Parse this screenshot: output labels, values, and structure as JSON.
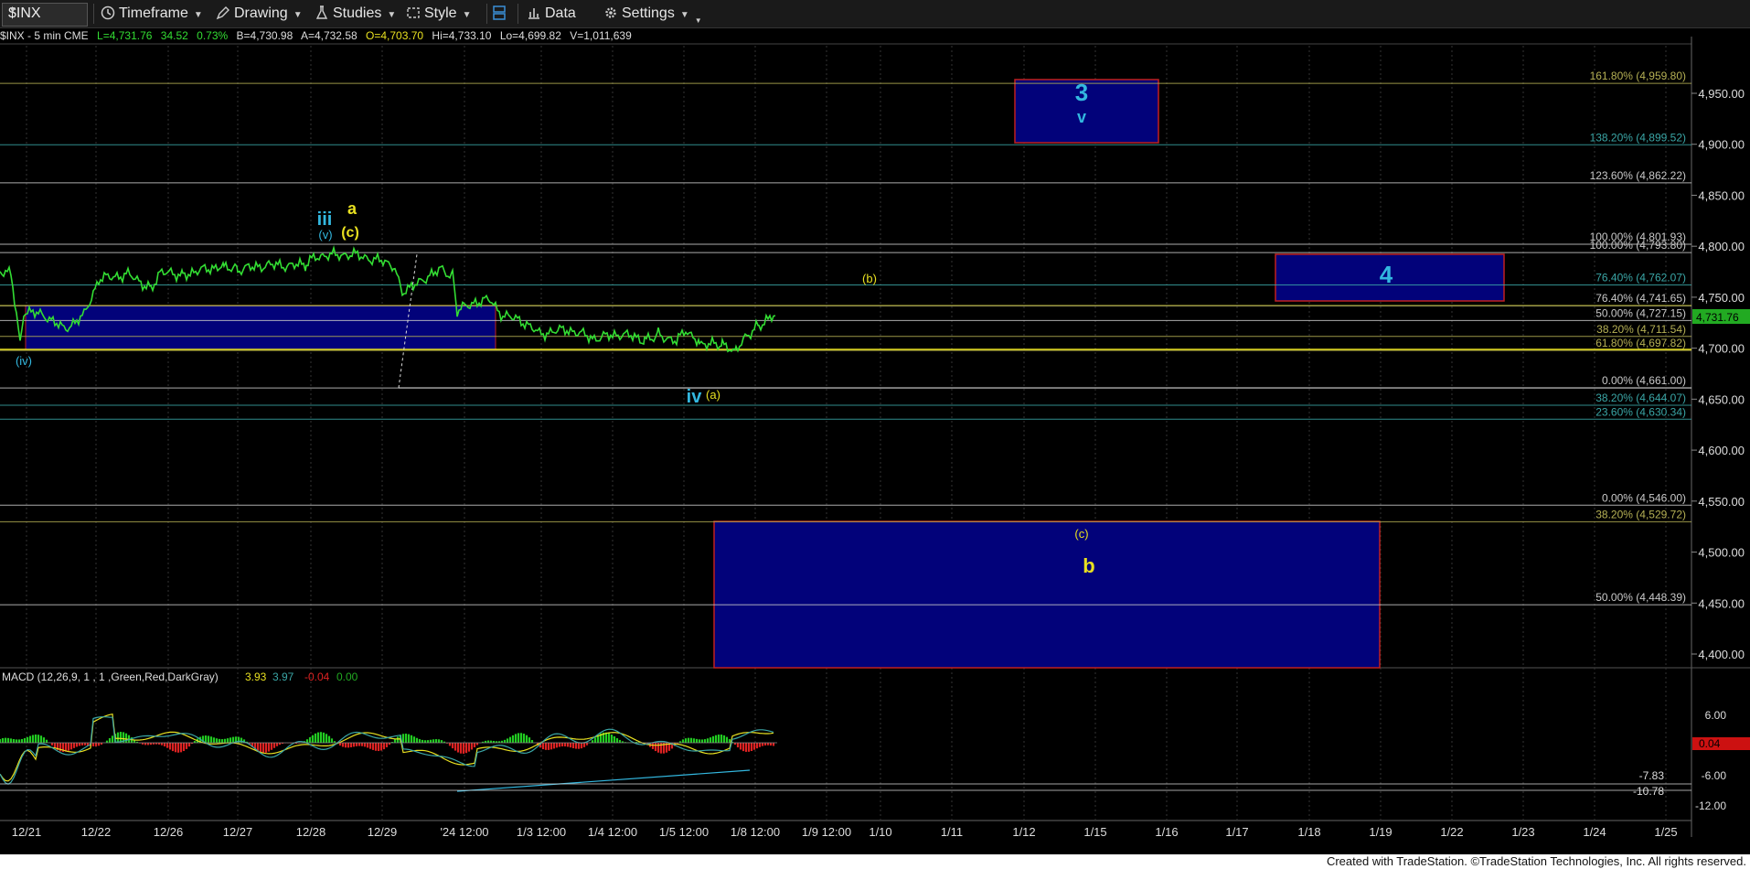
{
  "toolbar": {
    "symbol": "$INX",
    "timeframe": "Timeframe",
    "drawing": "Drawing",
    "studies": "Studies",
    "style": "Style",
    "data": "Data",
    "settings": "Settings"
  },
  "status": {
    "symbol": "$INX - 5 min  CME",
    "last": "L=4,731.76",
    "chg": "34.52",
    "pct": "0.73%",
    "bid": "B=4,730.98",
    "ask": "A=4,732.58",
    "open": "O=4,703.70",
    "hi": "Hi=4,733.10",
    "lo": "Lo=4,699.82",
    "vol": "V=1,011,639"
  },
  "price_axis": {
    "labels": [
      "4,950.00",
      "4,900.00",
      "4,850.00",
      "4,800.00",
      "4,750.00",
      "4,700.00",
      "4,650.00",
      "4,600.00",
      "4,550.00",
      "4,500.00",
      "4,450.00",
      "4,400.00"
    ],
    "last_price": "4,731.76"
  },
  "macd_axis": {
    "labels": [
      "6.00",
      "-6.00",
      "-12.00"
    ],
    "value_badge": "0.04",
    "marker_a": "-7.83",
    "marker_b": "-10.78"
  },
  "macd_legend": {
    "name": "MACD (12,26,9, 1 , 1 ,Green,Red,DarkGray)",
    "v1": "3.93",
    "v2": "3.97",
    "v3": "-0.04",
    "v4": "0.00"
  },
  "time_axis": {
    "labels": [
      "12/21",
      "12/22",
      "12/26",
      "12/27",
      "12/28",
      "12/29",
      "'24 12:00",
      "1/3 12:00",
      "1/4 12:00",
      "1/5 12:00",
      "1/8 12:00",
      "1/9 12:00",
      "1/10",
      "1/11",
      "1/12",
      "1/15",
      "1/16",
      "1/17",
      "1/18",
      "1/19",
      "1/22",
      "1/23",
      "1/24",
      "1/25"
    ]
  },
  "fib_levels": [
    {
      "label": "161.80% (4,959.80)",
      "price": 4959.8,
      "color": "#b5b054"
    },
    {
      "label": "138.20% (4,899.52)",
      "price": 4899.52,
      "color": "#3aa6a6"
    },
    {
      "label": "123.60% (4,862.22)",
      "price": 4862.22,
      "color": "#c9c9c9"
    },
    {
      "label": "100.00% (4,801.93)",
      "price": 4801.93,
      "color": "#c9c9c9"
    },
    {
      "label": "100.00% (4,793.80)",
      "price": 4793.8,
      "color": "#c9c9c9"
    },
    {
      "label": "76.40% (4,762.07)",
      "price": 4762.07,
      "color": "#3aa6a6"
    },
    {
      "label": "76.40% (4,741.65)",
      "price": 4741.65,
      "color": "#c9c9c9"
    },
    {
      "label": "50.00% (4,727.15)",
      "price": 4727.15,
      "color": "#c9c9c9"
    },
    {
      "label": "38.20% (4,711.54)",
      "price": 4711.54,
      "color": "#b5b054"
    },
    {
      "label": "61.80% (4,697.82)",
      "price": 4697.82,
      "color": "#b5b054"
    },
    {
      "label": "0.00% (4,661.00)",
      "price": 4661.0,
      "color": "#c9c9c9"
    },
    {
      "label": "38.20% (4,644.07)",
      "price": 4644.07,
      "color": "#3aa6a6"
    },
    {
      "label": "23.60% (4,630.34)",
      "price": 4630.34,
      "color": "#3aa6a6"
    },
    {
      "label": "0.00% (4,546.00)",
      "price": 4546.0,
      "color": "#c9c9c9"
    },
    {
      "label": "38.20% (4,529.72)",
      "price": 4529.72,
      "color": "#b5b054"
    },
    {
      "label": "50.00% (4,448.39)",
      "price": 4448.39,
      "color": "#c9c9c9"
    }
  ],
  "wave_labels": {
    "w3": "3",
    "wv": "v",
    "w4": "4",
    "wb_small": "(b)",
    "wc_small": "(c)",
    "wb": "b",
    "wiii": "iii",
    "wa": "a",
    "wv_small": "(v)",
    "wc_paren": "(c)",
    "wiv_small": "(iv)",
    "wiv": "iv",
    "wa_small": "(a)"
  },
  "colors": {
    "price_line": "#33dd33",
    "box_fill": "#02027a",
    "box_border": "#c02020",
    "cyan": "#33b8e0",
    "yellow": "#e8e020",
    "macd_pos": "#22cc22",
    "macd_neg": "#dd2222"
  },
  "footer": "Created with TradeStation. ©TradeStation Technologies, Inc. All rights reserved."
}
